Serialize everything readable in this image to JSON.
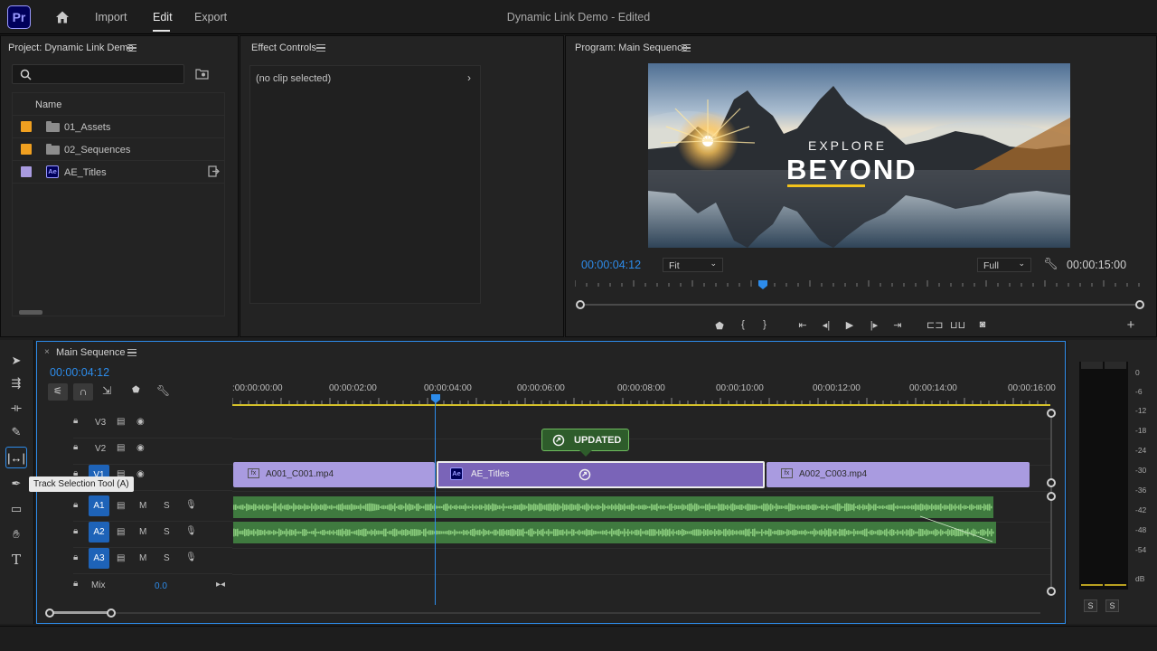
{
  "app": {
    "logo": "Pr",
    "document_title": "Dynamic Link Demo - Edited"
  },
  "nav": {
    "tabs": [
      {
        "label": "Import"
      },
      {
        "label": "Edit"
      },
      {
        "label": "Export"
      }
    ],
    "active": "Edit"
  },
  "project_panel": {
    "title": "Project: Dynamic Link Demo",
    "column_name": "Name",
    "items": [
      {
        "label": "01_Assets",
        "type": "folder",
        "color": "#f0a020"
      },
      {
        "label": "02_Sequences",
        "type": "folder",
        "color": "#f0a020"
      },
      {
        "label": "AE_Titles",
        "type": "after-effects-comp",
        "badge": "Ae",
        "color": "#a99be0"
      }
    ]
  },
  "effect_controls": {
    "title": "Effect Controls",
    "empty_text": "(no clip selected)"
  },
  "program_monitor": {
    "title": "Program: Main Sequence",
    "overlay_small": "EXPLORE",
    "overlay_large": "BEYOND",
    "current_timecode": "00:00:04:12",
    "fit_label": "Fit",
    "quality_label": "Full",
    "duration": "00:00:15:00",
    "playhead_fraction": 0.33
  },
  "timeline": {
    "tab_title": "Main Sequence",
    "close_glyph": "×",
    "timecode": "00:00:04:12",
    "ruler": [
      ":00:00:00:00",
      "00:00:02:00",
      "00:00:04:00",
      "00:00:06:00",
      "00:00:08:00",
      "00:00:10:00",
      "00:00:12:00",
      "00:00:14:00",
      "00:00:16:00"
    ],
    "video_tracks": [
      {
        "label": "V3"
      },
      {
        "label": "V2"
      },
      {
        "label": "V1"
      }
    ],
    "audio_tracks": [
      {
        "label": "A1"
      },
      {
        "label": "A2"
      },
      {
        "label": "A3"
      }
    ],
    "mute_label": "M",
    "solo_label": "S",
    "mix_label": "Mix",
    "mix_value": "0.0",
    "clips": [
      {
        "name": "A001_C001.mp4",
        "badge": "fx"
      },
      {
        "name": "AE_Titles",
        "badge": "Ae"
      },
      {
        "name": "A002_C003.mp4",
        "badge": "fx"
      }
    ],
    "updated_badge": "UPDATED",
    "tooltip": "Track Selection Tool (A)"
  },
  "audio_meter": {
    "labels": [
      "0",
      "-6",
      "-12",
      "-18",
      "-24",
      "-30",
      "-36",
      "-42",
      "-48",
      "-54",
      "dB"
    ],
    "solo_buttons": [
      "S",
      "S"
    ]
  },
  "colors": {
    "accent_blue": "#2d8ceb",
    "clip_purple": "#a99be0",
    "clip_selected": "#7a64b8",
    "audio_green": "#3f7a3f",
    "updated_green": "#2e5c2b"
  }
}
